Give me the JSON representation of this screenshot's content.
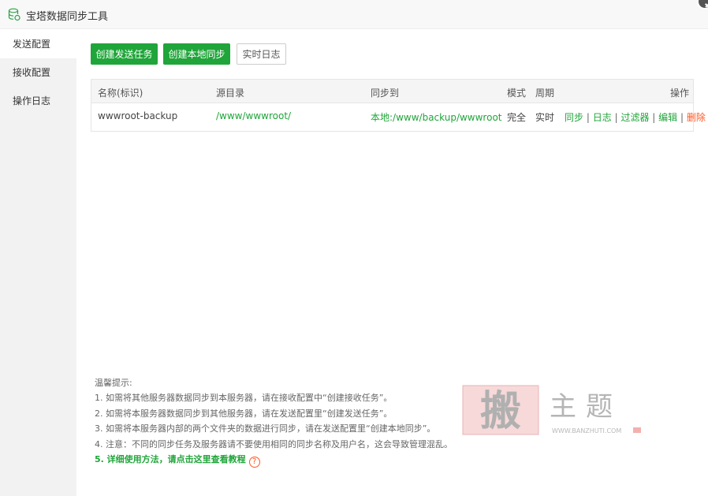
{
  "window": {
    "title": "宝塔数据同步工具"
  },
  "sidebar": {
    "items": [
      {
        "label": "发送配置",
        "active": true
      },
      {
        "label": "接收配置",
        "active": false
      },
      {
        "label": "操作日志",
        "active": false
      }
    ]
  },
  "toolbar": {
    "create_send_label": "创建发送任务",
    "create_local_label": "创建本地同步",
    "realtime_log_label": "实时日志"
  },
  "table": {
    "headers": {
      "name": "名称(标识)",
      "source": "源目录",
      "target": "同步到",
      "mode": "模式",
      "period": "周期",
      "actions": "操作"
    },
    "rows": [
      {
        "name": "wwwroot-backup",
        "source": "/www/wwwroot/",
        "target": "本地:/www/backup/wwwroot",
        "mode": "完全",
        "period": "实时",
        "actions": {
          "sync": "同步",
          "log": "日志",
          "filter": "过滤器",
          "edit": "编辑",
          "delete": "删除",
          "separator": "|"
        }
      }
    ]
  },
  "tips": {
    "heading": "温馨提示:",
    "lines": [
      "1. 如需将其他服务器数据同步到本服务器，请在接收配置中“创建接收任务”。",
      "2. 如需将本服务器数据同步到其他服务器，请在发送配置里“创建发送任务”。",
      "3. 如需将本服务器内部的两个文件夹的数据进行同步，请在发送配置里“创建本地同步”。",
      "4. 注意：不同的同步任务及服务器请不要使用相同的同步名称及用户名，这会导致管理混乱。"
    ],
    "link_prefix": "5. ",
    "link_text": "详细使用方法，请点击这里查看教程",
    "help_glyph": "?"
  },
  "watermark": {
    "big_char": "搬",
    "text": "主题",
    "url": "WWW.BANZHUTI.COM"
  },
  "colors": {
    "accent": "#20a53a",
    "danger": "#ff5722",
    "sidebar_bg": "#f2f2f2"
  }
}
